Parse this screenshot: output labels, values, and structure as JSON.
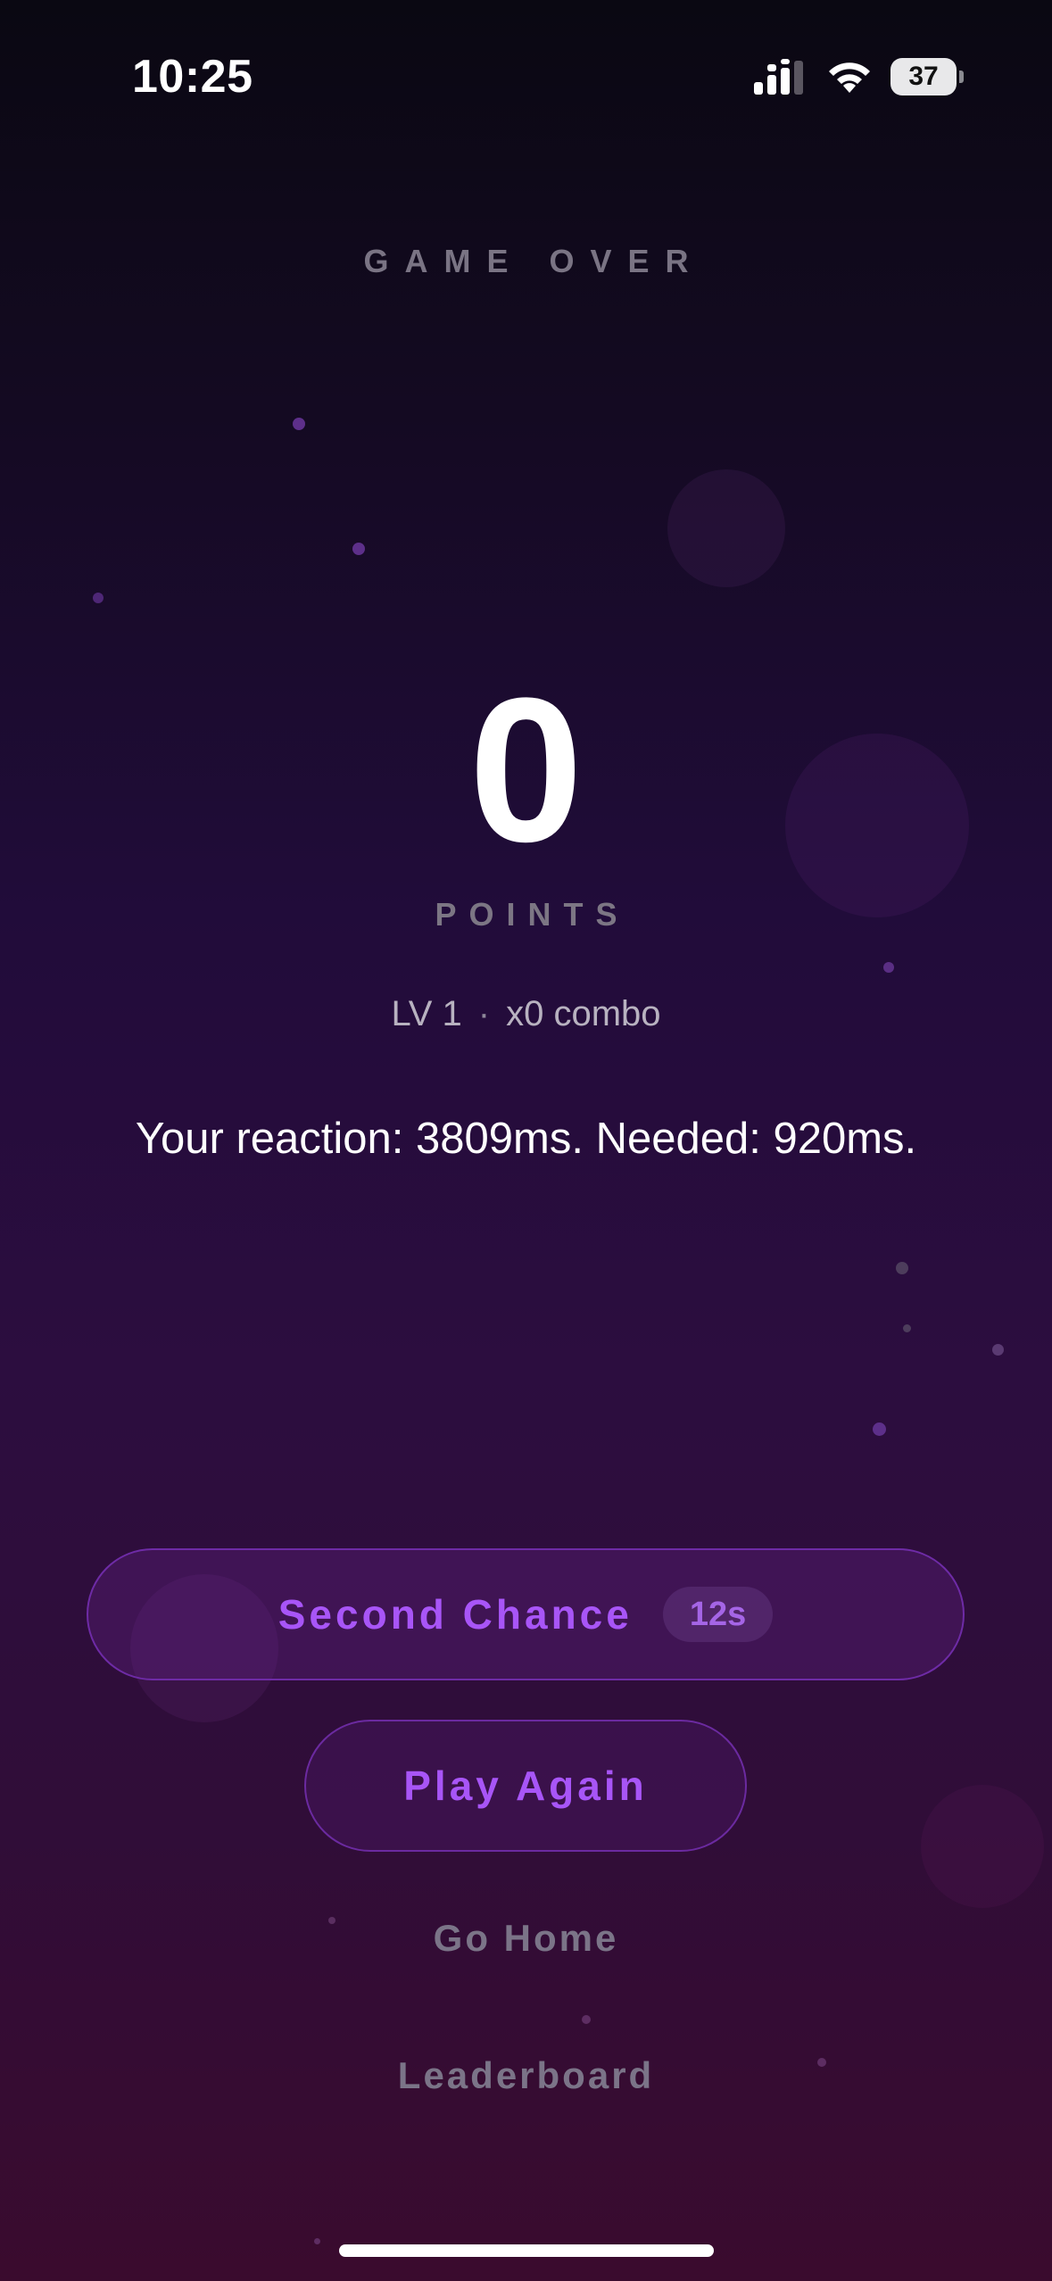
{
  "status_bar": {
    "time": "10:25",
    "battery_level": "37",
    "icons": [
      "signal-icon",
      "wifi-icon",
      "battery-icon"
    ]
  },
  "game_over": {
    "heading": "GAME OVER",
    "score": "0",
    "score_unit": "POINTS",
    "level": "LV 1",
    "separator": "·",
    "combo": "x0 combo",
    "reaction_message": "Your reaction: 3809ms. Needed: 920ms."
  },
  "actions": {
    "second_chance_label": "Second Chance",
    "second_chance_timer": "12s",
    "play_again_label": "Play Again",
    "go_home_label": "Go Home",
    "leaderboard_label": "Leaderboard"
  },
  "colors": {
    "accent": "#a855f7",
    "background_top": "#0a0812",
    "background_bottom": "#3a0b2e",
    "muted_text": "#7b7488"
  }
}
